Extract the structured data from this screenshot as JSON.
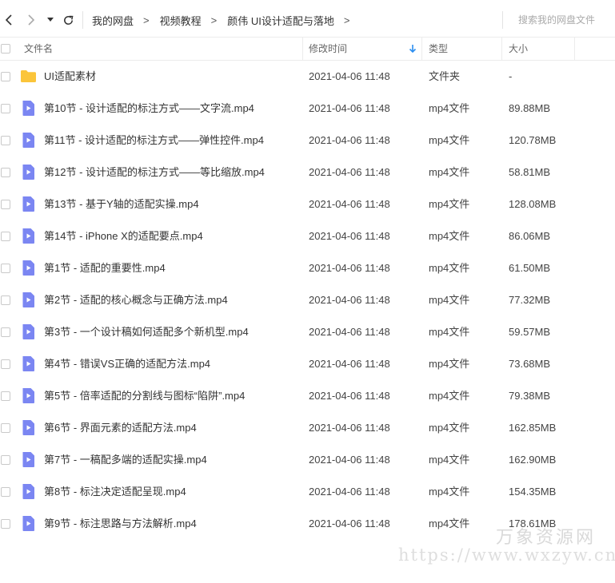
{
  "toolbar": {
    "back_icon": "chevron-left-icon",
    "forward_icon": "chevron-right-icon",
    "dropdown_icon": "caret-down-icon",
    "refresh_icon": "refresh-icon"
  },
  "breadcrumb": [
    {
      "label": "我的网盘"
    },
    {
      "label": "视频教程"
    },
    {
      "label": "颜伟 UI设计适配与落地"
    }
  ],
  "breadcrumb_separator": ">",
  "search": {
    "placeholder": "搜索我的网盘文件"
  },
  "columns": {
    "name": "文件名",
    "modified": "修改时间",
    "type": "类型",
    "size": "大小",
    "sort_icon": "arrow-down-icon",
    "sort_color": "#2b8ef0"
  },
  "colors": {
    "folder": "#fbc53a",
    "video_icon": "#7b86f2"
  },
  "files": [
    {
      "name": "UI适配素材",
      "modified": "2021-04-06 11:48",
      "type": "文件夹",
      "size": "-",
      "icon": "folder-icon"
    },
    {
      "name": "第10节 - 设计适配的标注方式——文字流.mp4",
      "modified": "2021-04-06 11:48",
      "type": "mp4文件",
      "size": "89.88MB",
      "icon": "video-file-icon"
    },
    {
      "name": "第11节 - 设计适配的标注方式——弹性控件.mp4",
      "modified": "2021-04-06 11:48",
      "type": "mp4文件",
      "size": "120.78MB",
      "icon": "video-file-icon"
    },
    {
      "name": "第12节 - 设计适配的标注方式——等比缩放.mp4",
      "modified": "2021-04-06 11:48",
      "type": "mp4文件",
      "size": "58.81MB",
      "icon": "video-file-icon"
    },
    {
      "name": "第13节 - 基于Y轴的适配实操.mp4",
      "modified": "2021-04-06 11:48",
      "type": "mp4文件",
      "size": "128.08MB",
      "icon": "video-file-icon"
    },
    {
      "name": "第14节 - iPhone X的适配要点.mp4",
      "modified": "2021-04-06 11:48",
      "type": "mp4文件",
      "size": "86.06MB",
      "icon": "video-file-icon"
    },
    {
      "name": "第1节 - 适配的重要性.mp4",
      "modified": "2021-04-06 11:48",
      "type": "mp4文件",
      "size": "61.50MB",
      "icon": "video-file-icon"
    },
    {
      "name": "第2节 - 适配的核心概念与正确方法.mp4",
      "modified": "2021-04-06 11:48",
      "type": "mp4文件",
      "size": "77.32MB",
      "icon": "video-file-icon"
    },
    {
      "name": "第3节 - 一个设计稿如何适配多个新机型.mp4",
      "modified": "2021-04-06 11:48",
      "type": "mp4文件",
      "size": "59.57MB",
      "icon": "video-file-icon"
    },
    {
      "name": "第4节 - 错误VS正确的适配方法.mp4",
      "modified": "2021-04-06 11:48",
      "type": "mp4文件",
      "size": "73.68MB",
      "icon": "video-file-icon"
    },
    {
      "name": "第5节 - 倍率适配的分割线与图标“陷阱”.mp4",
      "modified": "2021-04-06 11:48",
      "type": "mp4文件",
      "size": "79.38MB",
      "icon": "video-file-icon"
    },
    {
      "name": "第6节 - 界面元素的适配方法.mp4",
      "modified": "2021-04-06 11:48",
      "type": "mp4文件",
      "size": "162.85MB",
      "icon": "video-file-icon"
    },
    {
      "name": "第7节 - 一稿配多端的适配实操.mp4",
      "modified": "2021-04-06 11:48",
      "type": "mp4文件",
      "size": "162.90MB",
      "icon": "video-file-icon"
    },
    {
      "name": "第8节 - 标注决定适配呈现.mp4",
      "modified": "2021-04-06 11:48",
      "type": "mp4文件",
      "size": "154.35MB",
      "icon": "video-file-icon"
    },
    {
      "name": "第9节 - 标注思路与方法解析.mp4",
      "modified": "2021-04-06 11:48",
      "type": "mp4文件",
      "size": "178.61MB",
      "icon": "video-file-icon"
    }
  ],
  "watermark": {
    "line1": "万象资源网",
    "line2": "https://www.wxzyw.cn"
  }
}
